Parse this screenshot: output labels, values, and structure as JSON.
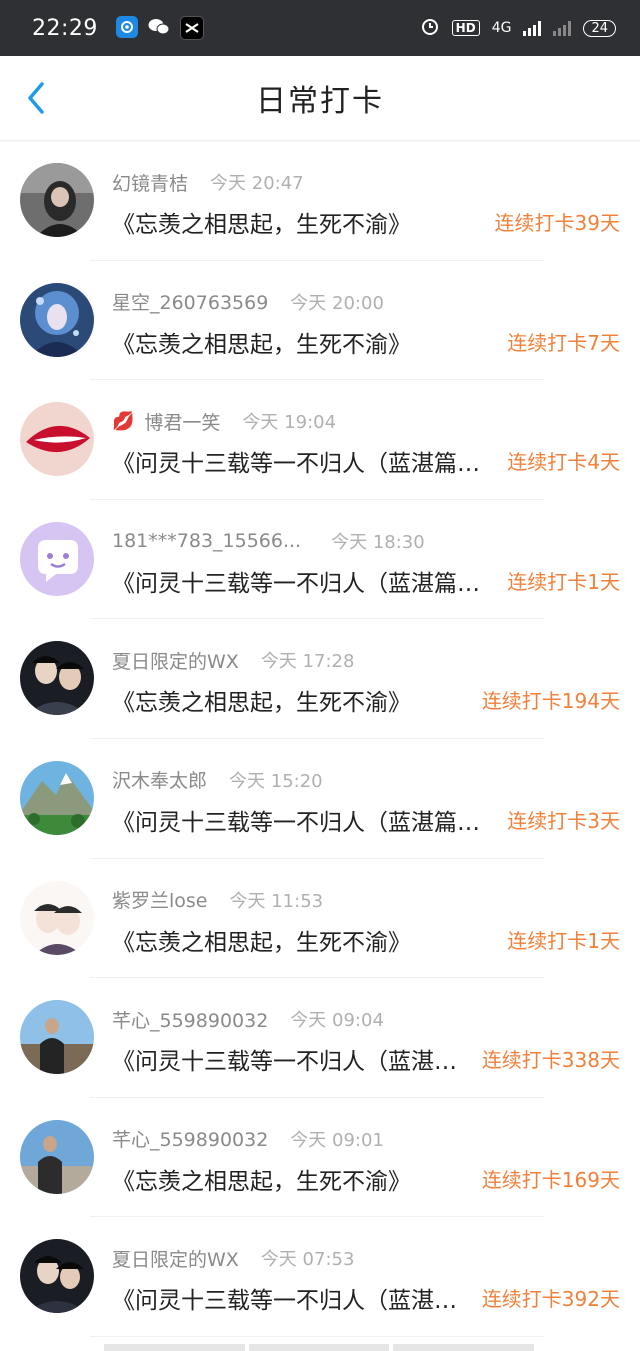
{
  "statusbar": {
    "time": "22:29",
    "network": "4G",
    "battery": "24"
  },
  "header": {
    "title": "日常打卡"
  },
  "items": [
    {
      "name": "幻镜青桔",
      "time": "今天 20:47",
      "content": "《忘羡之相思起，生死不渝》",
      "streak": "连续打卡39天"
    },
    {
      "name": "星空_260763569",
      "time": "今天 20:00",
      "content": "《忘羡之相思起，生死不渝》",
      "streak": "连续打卡7天"
    },
    {
      "name": "博君一笑",
      "time": "今天 19:04",
      "content": "《问灵十三载等一不归人（蓝湛篇…",
      "streak": "连续打卡4天"
    },
    {
      "name": "181***783_15566...",
      "time": "今天 18:30",
      "content": "《问灵十三载等一不归人（蓝湛篇…",
      "streak": "连续打卡1天"
    },
    {
      "name": "夏日限定的WX",
      "time": "今天 17:28",
      "content": "《忘羡之相思起，生死不渝》",
      "streak": "连续打卡194天"
    },
    {
      "name": "沢木奉太郎",
      "time": "今天 15:20",
      "content": "《问灵十三载等一不归人（蓝湛篇…",
      "streak": "连续打卡3天"
    },
    {
      "name": "紫罗兰lose",
      "time": "今天 11:53",
      "content": "《忘羡之相思起，生死不渝》",
      "streak": "连续打卡1天"
    },
    {
      "name": "芊心_559890032",
      "time": "今天 09:04",
      "content": "《问灵十三载等一不归人（蓝湛…",
      "streak": "连续打卡338天"
    },
    {
      "name": "芊心_559890032",
      "time": "今天 09:01",
      "content": "《忘羡之相思起，生死不渝》",
      "streak": "连续打卡169天"
    },
    {
      "name": "夏日限定的WX",
      "time": "今天 07:53",
      "content": "《问灵十三载等一不归人（蓝湛…",
      "streak": "连续打卡392天"
    }
  ],
  "colors": {
    "accent": "#1e9be9",
    "streak": "#f2803a",
    "statusbar": "#2f3033"
  }
}
